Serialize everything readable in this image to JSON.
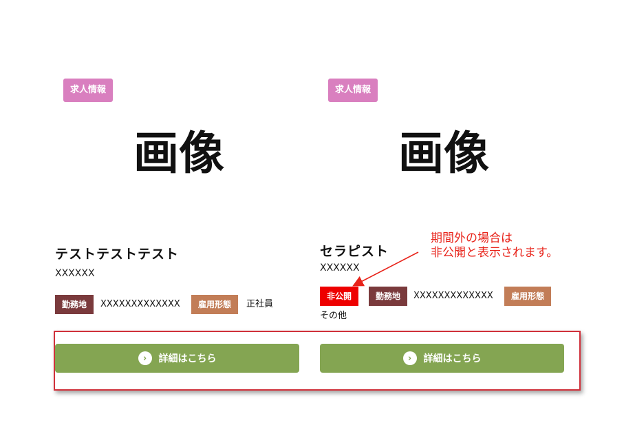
{
  "cards": [
    {
      "category": "求人情報",
      "image_text": "画像",
      "title": "テストテストテスト",
      "subtitle": "XXXXXX",
      "place_label": "勤務地",
      "place_value": "XXXXXXXXXXXXX",
      "type_label": "雇用形態",
      "type_value": "正社員",
      "button_label": "詳細はこちら"
    },
    {
      "category": "求人情報",
      "image_text": "画像",
      "title": "セラピスト",
      "subtitle": "XXXXXX",
      "status_label": "非公開",
      "place_label": "勤務地",
      "place_value": "XXXXXXXXXXXXX",
      "type_label": "雇用形態",
      "type_value": "その他",
      "button_label": "詳細はこちら"
    }
  ],
  "annotation": {
    "line1": "期間外の場合は",
    "line2": "非公開と表示されます。",
    "color": "#e8231a"
  },
  "colors": {
    "category_badge": "#d97fbf",
    "place_tag": "#7a3a3c",
    "type_tag": "#c27d57",
    "private_tag": "#ee0000",
    "button": "#84a552",
    "highlight_border": "#d0303a"
  },
  "icons": {
    "button_icon": "chevron-right-circle-icon"
  }
}
